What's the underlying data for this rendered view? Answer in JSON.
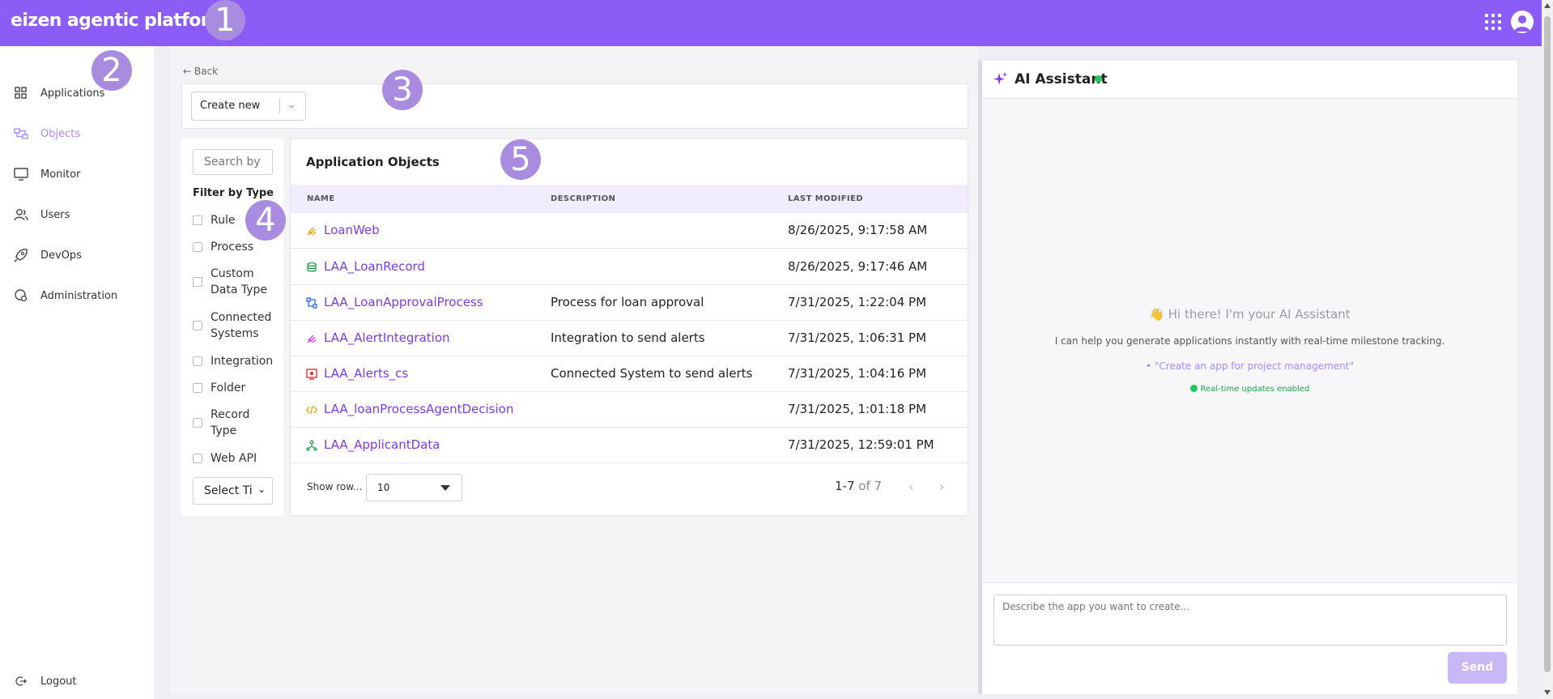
{
  "header": {
    "brand": "eizen agentic platform"
  },
  "badges": [
    "1",
    "2",
    "3",
    "4",
    "5"
  ],
  "sidebar": {
    "items": [
      {
        "label": "Applications",
        "icon": "grid-icon"
      },
      {
        "label": "Objects",
        "icon": "objects-icon",
        "active": true
      },
      {
        "label": "Monitor",
        "icon": "monitor-icon"
      },
      {
        "label": "Users",
        "icon": "users-icon"
      },
      {
        "label": "DevOps",
        "icon": "rocket-icon"
      },
      {
        "label": "Administration",
        "icon": "admin-icon"
      }
    ],
    "logout": "Logout"
  },
  "main": {
    "back": "Back",
    "create_new": "Create new",
    "filter": {
      "search_placeholder": "Search by",
      "title": "Filter by Type",
      "types": [
        "Rule",
        "Process",
        "Custom Data Type",
        "Connected Systems",
        "Integration",
        "Folder",
        "Record Type",
        "Web API"
      ],
      "select_time": "Select Ti"
    },
    "table": {
      "title": "Application Objects",
      "columns": [
        "NAME",
        "DESCRIPTION",
        "LAST MODIFIED"
      ],
      "rows": [
        {
          "name": "LoanWeb",
          "description": "",
          "modified": "8/26/2025, 9:17:58 AM",
          "icon": "web-icon",
          "color": "#f59e0b"
        },
        {
          "name": "LAA_LoanRecord",
          "description": "",
          "modified": "8/26/2025, 9:17:46 AM",
          "icon": "database-icon",
          "color": "#16a34a"
        },
        {
          "name": "LAA_LoanApprovalProcess",
          "description": "Process for loan approval",
          "modified": "7/31/2025, 1:22:04 PM",
          "icon": "process-icon",
          "color": "#2563eb"
        },
        {
          "name": "LAA_AlertIntegration",
          "description": "Integration to send alerts",
          "modified": "7/31/2025, 1:06:31 PM",
          "icon": "integration-icon",
          "color": "#d946ef"
        },
        {
          "name": "LAA_Alerts_cs",
          "description": "Connected System to send alerts",
          "modified": "7/31/2025, 1:04:16 PM",
          "icon": "connected-system-icon",
          "color": "#dc2626"
        },
        {
          "name": "LAA_loanProcessAgentDecision",
          "description": "",
          "modified": "7/31/2025, 1:01:18 PM",
          "icon": "code-icon",
          "color": "#f59e0b"
        },
        {
          "name": "LAA_ApplicantData",
          "description": "",
          "modified": "7/31/2025, 12:59:01 PM",
          "icon": "data-type-icon",
          "color": "#16a34a"
        }
      ],
      "show_rows_label": "Show row...",
      "rows_per_page": "10",
      "range": "1-7",
      "of_total": "of 7"
    }
  },
  "assistant": {
    "title": "AI Assistant",
    "greeting": "👋 Hi there! I'm your AI Assistant",
    "subtitle": "I can help you generate applications instantly with real-time milestone tracking.",
    "example": "• \"Create an app for project management\"",
    "realtime": "Real-time updates enabled",
    "input_placeholder": "Describe the app you want to create...",
    "send": "Send"
  },
  "colors": {
    "brand": "#8b5cf6",
    "accent": "#7c3aed",
    "active_nav": "#a78bfa",
    "online": "#22c55e"
  }
}
